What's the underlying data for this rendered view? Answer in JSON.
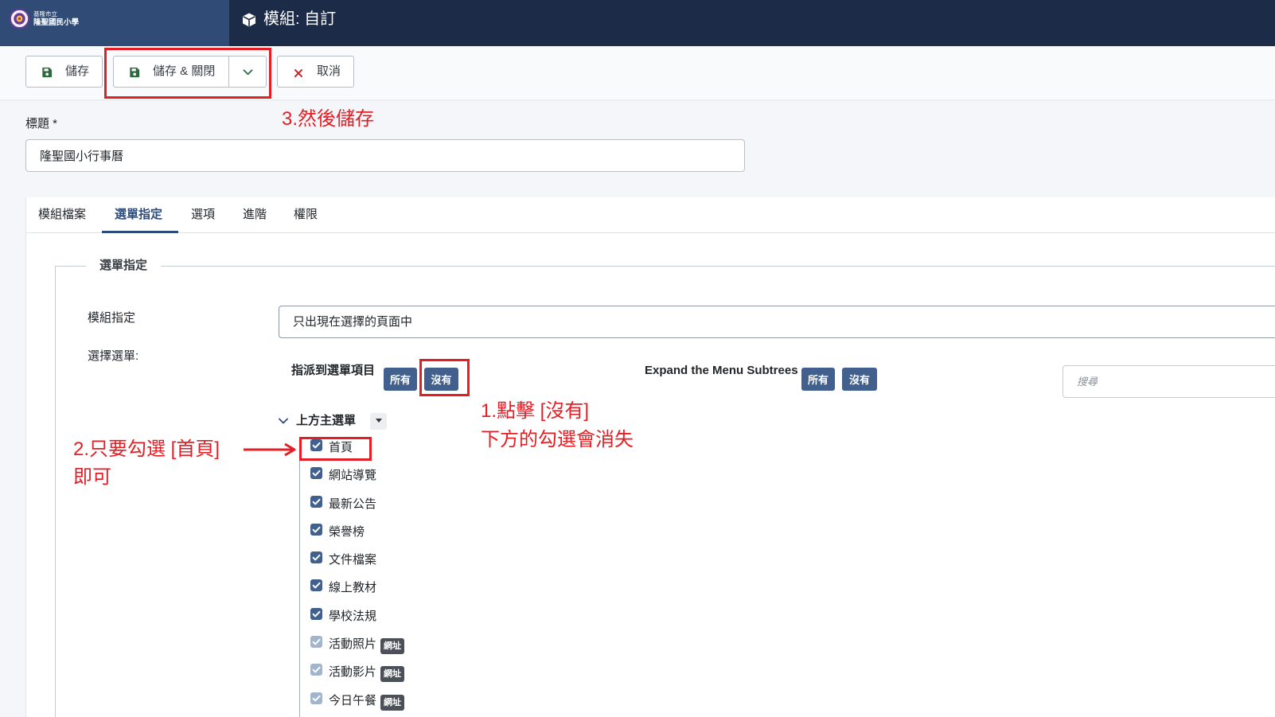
{
  "colors": {
    "header_bg": "#1b2b48",
    "logo_bg": "#2f4b76",
    "accent": "#41608e",
    "active_tab": "#2c4a7a",
    "annotation": "#e31e24",
    "badge_bg": "#4b5059",
    "checkbox_muted": "#a3b5cd"
  },
  "header": {
    "logo_icon": "school-seal-icon",
    "logo_line1": "基隆市立",
    "logo_line2": "隆聖國民小學",
    "title_icon": "cube-icon",
    "title": "模組: 自訂"
  },
  "toolbar": {
    "save": {
      "label": "儲存",
      "icon": "save-icon"
    },
    "save_close": {
      "label": "儲存 & 關閉",
      "icon": "save-icon",
      "dropdown_icon": "chevron-down-icon"
    },
    "cancel": {
      "label": "取消",
      "icon": "close-icon"
    }
  },
  "form": {
    "title_label": "標題 *",
    "title_value": "隆聖國小行事曆"
  },
  "tabs": [
    {
      "label": "模組檔案",
      "active": false
    },
    {
      "label": "選單指定",
      "active": true
    },
    {
      "label": "選項",
      "active": false
    },
    {
      "label": "進階",
      "active": false
    },
    {
      "label": "權限",
      "active": false
    }
  ],
  "menu_assignment": {
    "legend": "選單指定",
    "module_assign_label": "模組指定",
    "module_assign_value": "只出現在選擇的頁面中",
    "select_menu_label": "選擇選單:",
    "assign_items_label": "指派到選單項目",
    "assign_all_label": "所有",
    "assign_none_label": "沒有",
    "expand_label": "Expand the Menu Subtrees",
    "expand_all_label": "所有",
    "expand_none_label": "沒有",
    "search_placeholder": "搜尋",
    "menu_name": "上方主選單",
    "items": [
      {
        "label": "首頁",
        "checked": true,
        "disabled": false
      },
      {
        "label": "網站導覽",
        "checked": true,
        "disabled": false
      },
      {
        "label": "最新公告",
        "checked": true,
        "disabled": false
      },
      {
        "label": "榮譽榜",
        "checked": true,
        "disabled": false
      },
      {
        "label": "文件檔案",
        "checked": true,
        "disabled": false
      },
      {
        "label": "線上教材",
        "checked": true,
        "disabled": false
      },
      {
        "label": "學校法規",
        "checked": true,
        "disabled": false
      },
      {
        "label": "活動照片",
        "checked": true,
        "disabled": true,
        "badge": "網址"
      },
      {
        "label": "活動影片",
        "checked": true,
        "disabled": true,
        "badge": "網址"
      },
      {
        "label": "今日午餐",
        "checked": true,
        "disabled": true,
        "badge": "網址"
      }
    ]
  },
  "annotations": {
    "step1_line1": "1.點擊 [沒有]",
    "step1_line2": "下方的勾選會消失",
    "step2_line1": "2.只要勾選 [首頁]",
    "step2_line2": "即可",
    "step3": "3.然後儲存"
  }
}
